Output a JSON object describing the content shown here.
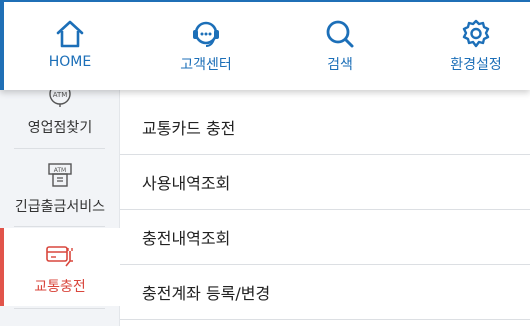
{
  "topnav": {
    "items": [
      {
        "label": "HOME",
        "icon": "home-icon"
      },
      {
        "label": "고객센터",
        "icon": "headset-icon"
      },
      {
        "label": "검색",
        "icon": "search-icon"
      },
      {
        "label": "환경설정",
        "icon": "gear-icon"
      }
    ]
  },
  "sidebar": {
    "items": [
      {
        "label": "영업점찾기",
        "icon": "atm-location-icon",
        "icon_text": "ATM"
      },
      {
        "label": "긴급출금서비스",
        "icon": "atm-withdrawal-icon",
        "icon_text": "ATM"
      },
      {
        "label": "교통충전",
        "icon": "card-charge-icon",
        "active": true
      }
    ]
  },
  "menu": {
    "items": [
      {
        "label": "교통카드 충전"
      },
      {
        "label": "사용내역조회"
      },
      {
        "label": "충전내역조회"
      },
      {
        "label": "충전계좌 등록/변경"
      }
    ]
  },
  "colors": {
    "accent_blue": "#1c6fb8",
    "active_red": "#d9473d"
  }
}
